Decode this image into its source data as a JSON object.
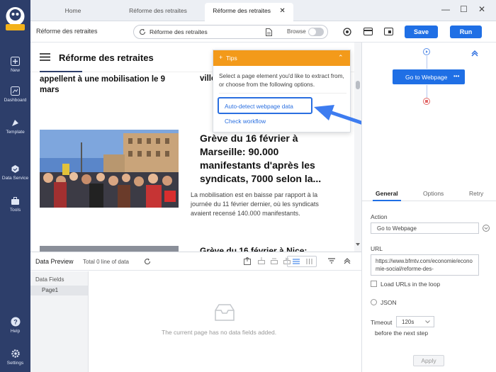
{
  "sidebar": {
    "logo_text": "Octoparse",
    "items": [
      {
        "label": "New",
        "icon": "plus-icon"
      },
      {
        "label": "Dashboard",
        "icon": "dashboard-icon"
      },
      {
        "label": "Template",
        "icon": "template-icon"
      },
      {
        "label": "Data Service",
        "icon": "data-service-icon"
      },
      {
        "label": "Tools",
        "icon": "toolbox-icon"
      },
      {
        "label": "Help",
        "icon": "help-icon"
      },
      {
        "label": "Settings",
        "icon": "settings-icon"
      }
    ]
  },
  "tabs": [
    {
      "label": "Home",
      "active": false
    },
    {
      "label": "Réforme des retraites",
      "active": false
    },
    {
      "label": "Réforme des retraites",
      "active": true,
      "close": "✕"
    }
  ],
  "window_controls": {
    "minimize": "—",
    "maximize": "☐",
    "close": "✕"
  },
  "toolbar": {
    "task_name": "Réforme des retraites",
    "url_value": "Réforme des retraites",
    "browse_label": "Browse",
    "save_label": "Save",
    "run_label": "Run"
  },
  "webpage": {
    "header_title": "Réforme des retraites",
    "left_snippet": "appellent à une mobilisation le 9 mars",
    "right_snippet": "ville",
    "article_title": "Grève du 16 février à Marseille: 90.000 manifestants d'après les syndicats, 7000 selon la...",
    "article_summary": "La mobilisation est en baisse par rapport à la journée du 11 février dernier, où les syndicats avaient recensé 140.000 manifestants.",
    "next_title_partial": "Grève du 16 février à Nice:"
  },
  "tips": {
    "title": "Tips",
    "body": "Select a page element you'd like to extract from, or choose from the following options.",
    "auto_detect": "Auto-detect webpage data",
    "check_workflow": "Check workflow"
  },
  "workflow": {
    "node_label": "Go to Webpage",
    "node_menu": "•••"
  },
  "panel": {
    "tabs": [
      "General",
      "Options",
      "Retry"
    ],
    "action_label": "Action",
    "action_value": "Go to Webpage",
    "url_label": "URL",
    "url_value": "https://www.bfmtv.com/economie/economie-social/reforme-des-",
    "load_urls_label": "Load URLs in the loop",
    "json_label": "JSON",
    "timeout_label": "Timeout",
    "timeout_value": "120s",
    "timeout_suffix": "before the next step",
    "apply_label": "Apply"
  },
  "preview": {
    "title": "Data Preview",
    "count": "Total 0 line of data",
    "fields_label": "Data Fields",
    "page_item": "Page1",
    "empty_message": "The current page has no data fields added."
  },
  "colors": {
    "sidebar": "#2d3e6a",
    "primary": "#1f6fe5",
    "tips_orange": "#f39a1a"
  }
}
